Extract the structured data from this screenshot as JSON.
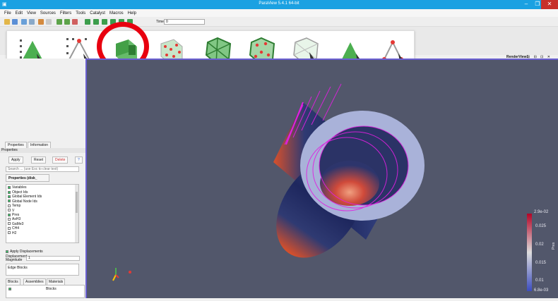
{
  "window": {
    "title": "ParaView 5.4.1 64-bit",
    "minimize": "–",
    "maximize": "❐",
    "close": "✕"
  },
  "menubar": [
    "File",
    "Edit",
    "View",
    "Sources",
    "Filters",
    "Tools",
    "Catalyst",
    "Macros",
    "Help"
  ],
  "toolbar": {
    "time_label": "Time:",
    "time_value": "0"
  },
  "render_view": {
    "label": "RenderView1",
    "buttons": "⊟ ⊟ ⊡ ✕"
  },
  "left_panel": {
    "tabs": [
      "Properties",
      "Information"
    ],
    "title": "Properties",
    "buttons": {
      "apply": "Apply",
      "reset": "Reset",
      "delete": "Delete",
      "help": "?"
    },
    "search_placeholder": "Search ... (use Esc to clear text)",
    "properties_header": "Properties (disk_",
    "variables_header": "Variables",
    "variables": [
      {
        "name": "Object Ids",
        "checked": true
      },
      {
        "name": "Global Element Ids",
        "checked": true
      },
      {
        "name": "Global Node Ids",
        "checked": true
      },
      {
        "name": "Temp",
        "checked": false
      },
      {
        "name": "V",
        "checked": false
      },
      {
        "name": "Pres",
        "checked": true
      },
      {
        "name": "AsH3",
        "checked": false
      },
      {
        "name": "GaMe3",
        "checked": false
      },
      {
        "name": "CH4",
        "checked": false
      },
      {
        "name": "H2",
        "checked": false
      }
    ],
    "apply_displacements": "Apply Displacements",
    "displacement_magnitude_label": "Displacement Magnitude",
    "displacement_magnitude_value": "1",
    "edge_blocks": "Edge Blocks",
    "bottom_tabs": [
      "Blocks",
      "Assemblies",
      "Materials"
    ],
    "blocks_column": "Blocks"
  },
  "scalar_bar": {
    "title": "Pres",
    "labels": [
      "2.9e-02",
      "0.025",
      "0.02",
      "0.015",
      "0.01",
      "6.8e-03"
    ]
  },
  "colors": {
    "viewport_bg": "#52576b",
    "selection_highlight": "#e8000f",
    "titlebar": "#1ba1e2"
  }
}
